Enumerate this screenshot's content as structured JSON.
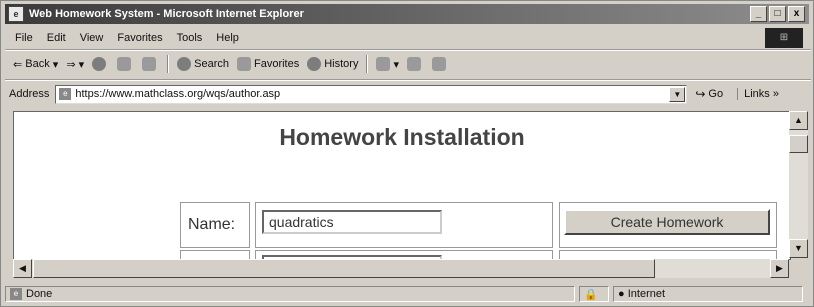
{
  "window": {
    "title": "Web Homework System - Microsoft Internet Explorer",
    "controls": [
      "_",
      "□",
      "x"
    ]
  },
  "menu": {
    "items": [
      "File",
      "Edit",
      "View",
      "Favorites",
      "Tools",
      "Help"
    ]
  },
  "toolbar": {
    "back": "Back",
    "search": "Search",
    "favorites": "Favorites",
    "history": "History"
  },
  "address": {
    "label": "Address",
    "url": "https://www.mathclass.org/wqs/author.asp",
    "go": "Go",
    "links": "Links »"
  },
  "page": {
    "heading": "Homework Installation",
    "name_label": "Name:",
    "name_value": "quadratics",
    "create_button": "Create Homework"
  },
  "status": {
    "text": "Done",
    "zone": "Internet"
  }
}
